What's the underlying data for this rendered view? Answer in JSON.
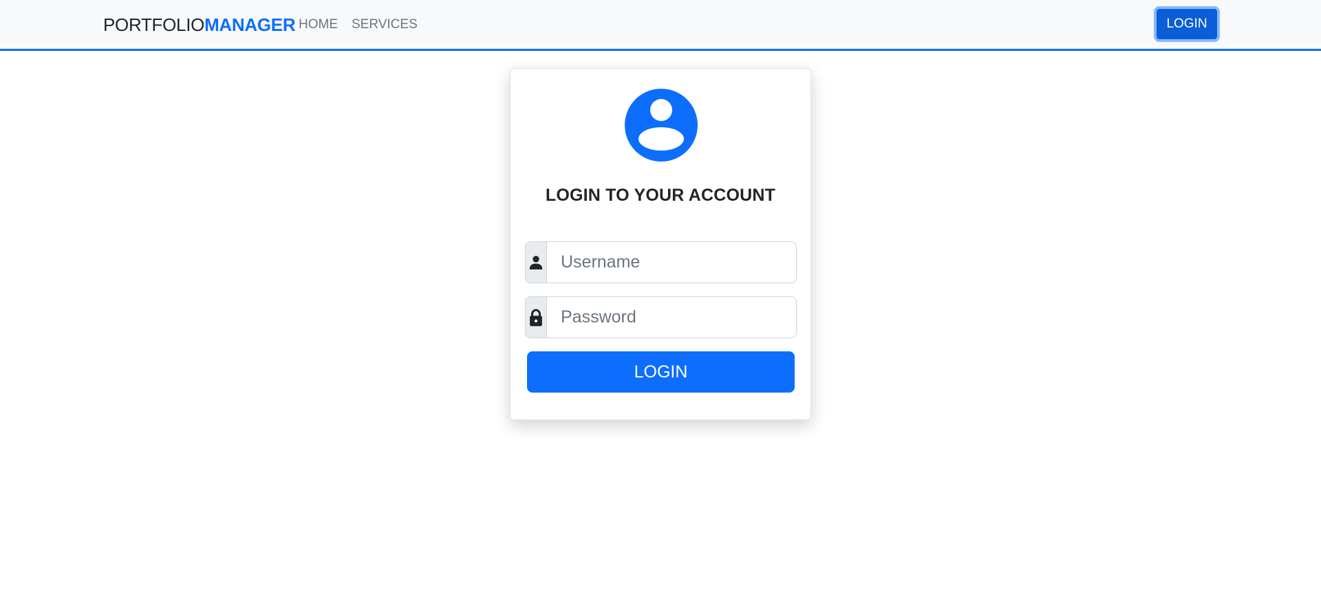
{
  "navbar": {
    "brand_part1": "PORTFOLIO",
    "brand_part2": "MANAGER",
    "links": [
      {
        "label": "HOME"
      },
      {
        "label": "SERVICES"
      }
    ],
    "login_label": "LOGIN"
  },
  "login_card": {
    "avatar_icon": "user-circle-icon",
    "title": "LOGIN TO YOUR ACCOUNT",
    "username": {
      "icon": "person-icon",
      "placeholder": "Username",
      "value": ""
    },
    "password": {
      "icon": "lock-icon",
      "placeholder": "Password",
      "value": ""
    },
    "submit_label": "LOGIN"
  },
  "colors": {
    "accent": "#0d6efd",
    "navbar_bg": "#f8f9fa",
    "addon_bg": "#e9ecef"
  }
}
